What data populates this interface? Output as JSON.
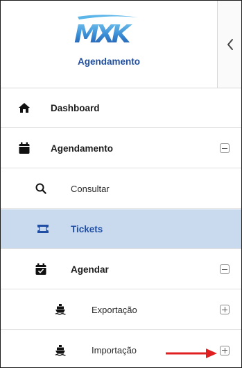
{
  "app": {
    "logo_text": "MXK",
    "title": "Agendamento",
    "collapse_icon": "chevron-left-icon"
  },
  "menu": {
    "dashboard": {
      "label": "Dashboard",
      "icon": "home-icon"
    },
    "agendamento": {
      "label": "Agendamento",
      "icon": "calendar-icon",
      "toggle": "minus",
      "expanded": true
    },
    "consultar": {
      "label": "Consultar",
      "icon": "search-icon"
    },
    "tickets": {
      "label": "Tickets",
      "icon": "ticket-icon",
      "selected": true
    },
    "agendar": {
      "label": "Agendar",
      "icon": "calendar-check-icon",
      "toggle": "minus",
      "expanded": true
    },
    "exportacao": {
      "label": "Exportação",
      "icon": "ship-icon",
      "toggle": "plus",
      "expanded": false
    },
    "importacao": {
      "label": "Importação",
      "icon": "ship-icon",
      "toggle": "plus",
      "expanded": false
    }
  },
  "colors": {
    "brand_blue": "#1f4ea3",
    "logo_light_blue": "#5bb5e8",
    "selected_bg": "#c9daef",
    "annotation_arrow": "#e02020"
  }
}
